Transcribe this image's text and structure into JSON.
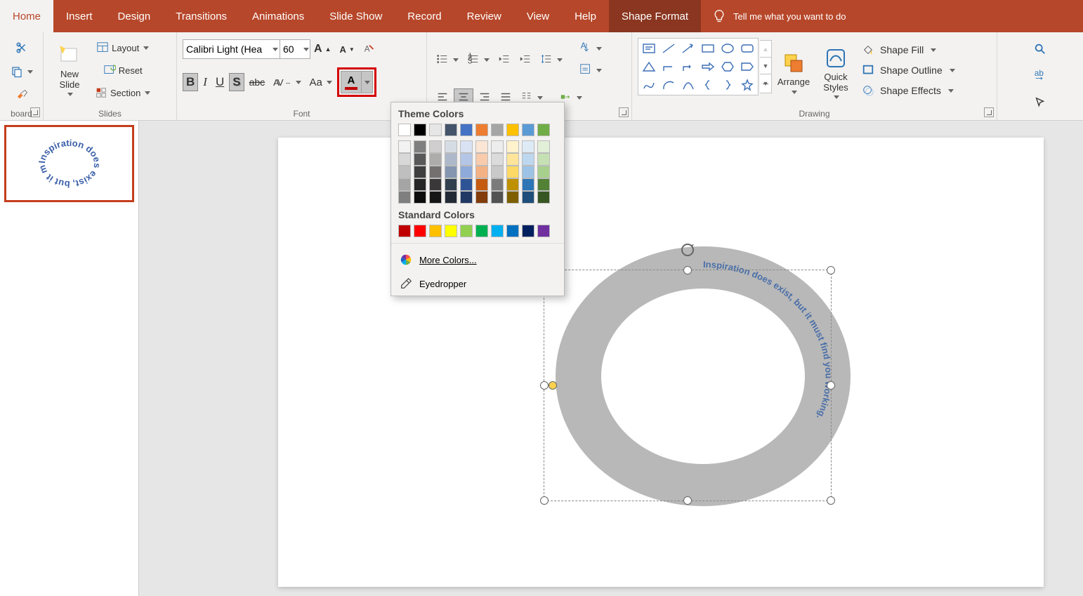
{
  "tabs": {
    "home": "Home",
    "insert": "Insert",
    "design": "Design",
    "transitions": "Transitions",
    "animations": "Animations",
    "slideshow": "Slide Show",
    "record": "Record",
    "review": "Review",
    "view": "View",
    "help": "Help",
    "shapeformat": "Shape Format",
    "tellme": "Tell me what you want to do"
  },
  "groups": {
    "clipboard": "board",
    "slides": "Slides",
    "font": "Font",
    "paragraph": "",
    "drawing": "Drawing"
  },
  "slides_group": {
    "new_slide": "New Slide",
    "layout": "Layout",
    "reset": "Reset",
    "section": "Section"
  },
  "font": {
    "name": "Calibri Light (Hea",
    "size": "60",
    "bold": "B",
    "italic": "I",
    "underline": "U",
    "shadow": "S",
    "change_case": "Aa"
  },
  "drawing": {
    "arrange": "Arrange",
    "quick": "Quick Styles",
    "fill": "Shape Fill",
    "outline": "Shape Outline",
    "effects": "Shape Effects"
  },
  "color_popup": {
    "theme": "Theme Colors",
    "standard": "Standard Colors",
    "more": "More Colors...",
    "eyedropper": "Eyedropper"
  },
  "theme_row1": [
    "#ffffff",
    "#000000",
    "#e7e6e6",
    "#44546a",
    "#4472c4",
    "#ed7d31",
    "#a5a5a5",
    "#ffc000",
    "#5b9bd5",
    "#70ad47"
  ],
  "theme_shades": [
    [
      "#f2f2f2",
      "#7f7f7f",
      "#d0cece",
      "#d6dce4",
      "#d9e2f3",
      "#fbe5d5",
      "#ededed",
      "#fff2cc",
      "#deebf6",
      "#e2efd9"
    ],
    [
      "#d8d8d8",
      "#595959",
      "#aeabab",
      "#adb9ca",
      "#b4c6e7",
      "#f7cbac",
      "#dbdbdb",
      "#fee599",
      "#bdd7ee",
      "#c5e0b3"
    ],
    [
      "#bfbfbf",
      "#3f3f3f",
      "#757070",
      "#8496b0",
      "#8eaadb",
      "#f4b183",
      "#c9c9c9",
      "#ffd965",
      "#9cc3e5",
      "#a8d08d"
    ],
    [
      "#a5a5a5",
      "#262626",
      "#3a3838",
      "#323f4f",
      "#2f5496",
      "#c55a11",
      "#7b7b7b",
      "#bf9000",
      "#2e75b5",
      "#538135"
    ],
    [
      "#7f7f7f",
      "#0c0c0c",
      "#171616",
      "#222a35",
      "#1f3864",
      "#833c0b",
      "#525252",
      "#7f6000",
      "#1e4e79",
      "#375623"
    ]
  ],
  "standard_colors": [
    "#c00000",
    "#ff0000",
    "#ffc000",
    "#ffff00",
    "#92d050",
    "#00b050",
    "#00b0f0",
    "#0070c0",
    "#002060",
    "#7030a0"
  ],
  "slide_text": "Inspiration does exist, but it must find you working."
}
